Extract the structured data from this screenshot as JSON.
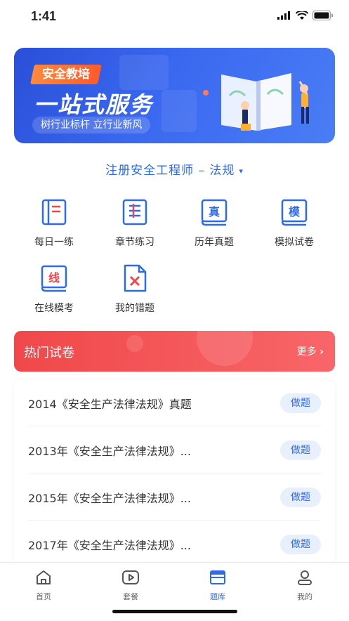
{
  "status": {
    "time": "1:41"
  },
  "banner": {
    "tag": "安全教培",
    "title": "一站式服务",
    "subtitle": "树行业标杆 立行业新风"
  },
  "exam": {
    "selected": "注册安全工程师 – 法规"
  },
  "features": [
    {
      "label": "每日一练",
      "icon": "notebook-icon"
    },
    {
      "label": "章节练习",
      "icon": "list-book-icon"
    },
    {
      "label": "历年真题",
      "icon": "book-zhen-icon",
      "glyph": "真"
    },
    {
      "label": "模拟试卷",
      "icon": "book-mo-icon",
      "glyph": "模"
    },
    {
      "label": "在线模考",
      "icon": "book-xian-icon",
      "glyph": "线"
    },
    {
      "label": "我的错题",
      "icon": "wrong-doc-icon"
    }
  ],
  "hot": {
    "title": "热门试卷",
    "more": "更多"
  },
  "papers": [
    {
      "name": "2014《安全生产法律法规》真题",
      "action": "做题"
    },
    {
      "name": "2013年《安全生产法律法规》...",
      "action": "做题"
    },
    {
      "name": "2015年《安全生产法律法规》...",
      "action": "做题"
    },
    {
      "name": "2017年《安全生产法律法规》...",
      "action": "做题"
    }
  ],
  "tabs": [
    {
      "label": "首页",
      "icon": "home-icon"
    },
    {
      "label": "套餐",
      "icon": "play-icon"
    },
    {
      "label": "题库",
      "icon": "question-bank-icon",
      "active": true
    },
    {
      "label": "我的",
      "icon": "user-icon"
    }
  ],
  "colors": {
    "accent": "#2f6be9",
    "hot": "#f0484a",
    "banner": "#3a68f0"
  }
}
